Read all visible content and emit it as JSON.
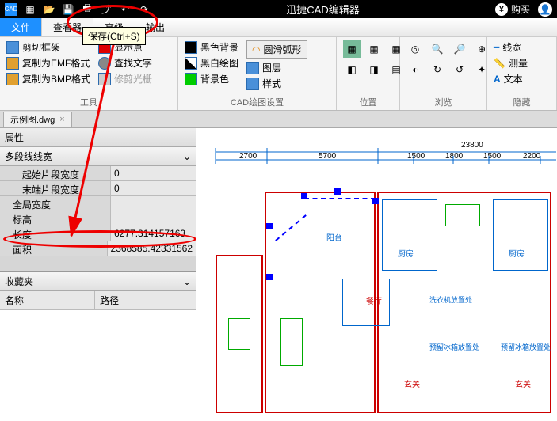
{
  "titlebar": {
    "app_title": "迅捷CAD编辑器",
    "buy_label": "购买"
  },
  "tooltip": {
    "text": "保存(Ctrl+S)"
  },
  "menu": {
    "file": "文件",
    "viewer": "查看器",
    "advanced": "高级",
    "output": "输出"
  },
  "ribbon": {
    "tools": {
      "clip_frame": "剪切框架",
      "copy_emf": "复制为EMF格式",
      "copy_bmp": "复制为BMP格式",
      "show_points": "显示点",
      "find_text": "查找文字",
      "clip_grating": "修剪光栅",
      "group": "工具"
    },
    "cad_settings": {
      "black_bg": "黑色背景",
      "bw_drawing": "黑白绘图",
      "bg_color": "背景色",
      "smooth_arc": "圆滑弧形",
      "layers": "图层",
      "style": "样式",
      "group": "CAD绘图设置"
    },
    "position": {
      "group": "位置"
    },
    "browse": {
      "group": "浏览"
    },
    "hidden": {
      "line_width": "线宽",
      "measure": "测量",
      "text": "文本",
      "group": "隐藏"
    }
  },
  "doc": {
    "tab_name": "示例图.dwg"
  },
  "panel": {
    "title": "属性",
    "subtitle": "多段线线宽",
    "favorites_title": "收藏夹",
    "col_name": "名称",
    "col_path": "路径"
  },
  "props": [
    {
      "name": "起始片段宽度",
      "value": "0"
    },
    {
      "name": "末端片段宽度",
      "value": "0"
    },
    {
      "name": "全局宽度",
      "value": ""
    },
    {
      "name": "标高",
      "value": ""
    },
    {
      "name": "长度",
      "value": "6277.314157163"
    },
    {
      "name": "面积",
      "value": "2368585.42331562"
    }
  ],
  "ruler": {
    "v1": "2700",
    "v2": "5700",
    "v3": "23800",
    "v4": "1500",
    "v5": "1800",
    "v6": "1500",
    "v7": "2200"
  },
  "rooms": {
    "balcony": "阳台",
    "kitchen": "厨房",
    "dining": "餐厅",
    "entrance": "玄关",
    "laundry": "洗衣机放置处",
    "fridge": "预留冰箱放置处"
  },
  "annotation": {
    "length_circled": true
  }
}
